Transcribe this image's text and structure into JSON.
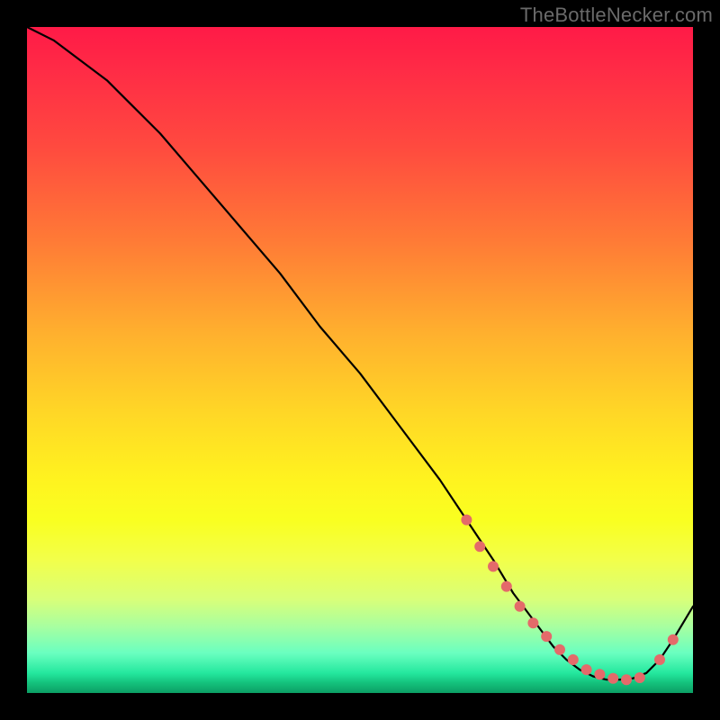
{
  "watermark": "TheBottleNecker.com",
  "colors": {
    "line": "#000000",
    "marker_fill": "#e46a6a",
    "marker_stroke": "#b94a4a"
  },
  "chart_data": {
    "type": "line",
    "title": "",
    "xlabel": "",
    "ylabel": "",
    "xlim": [
      0,
      100
    ],
    "ylim": [
      0,
      100
    ],
    "series": [
      {
        "name": "curve",
        "x": [
          0,
          4,
          8,
          12,
          16,
          20,
          26,
          32,
          38,
          44,
          50,
          56,
          62,
          66,
          70,
          73,
          76,
          79,
          81,
          83,
          85,
          87,
          89,
          91,
          93,
          95,
          97,
          100
        ],
        "values": [
          100,
          98,
          95,
          92,
          88,
          84,
          77,
          70,
          63,
          55,
          48,
          40,
          32,
          26,
          20,
          15,
          11,
          7,
          5,
          3.5,
          2.5,
          2,
          2,
          2.2,
          3,
          5,
          8,
          13
        ]
      }
    ],
    "markers": {
      "name": "highlight-points",
      "x": [
        66,
        68,
        70,
        72,
        74,
        76,
        78,
        80,
        82,
        84,
        86,
        88,
        90,
        92,
        95,
        97
      ],
      "values": [
        26,
        22,
        19,
        16,
        13,
        10.5,
        8.5,
        6.5,
        5,
        3.5,
        2.8,
        2.2,
        2,
        2.3,
        5,
        8
      ]
    }
  }
}
